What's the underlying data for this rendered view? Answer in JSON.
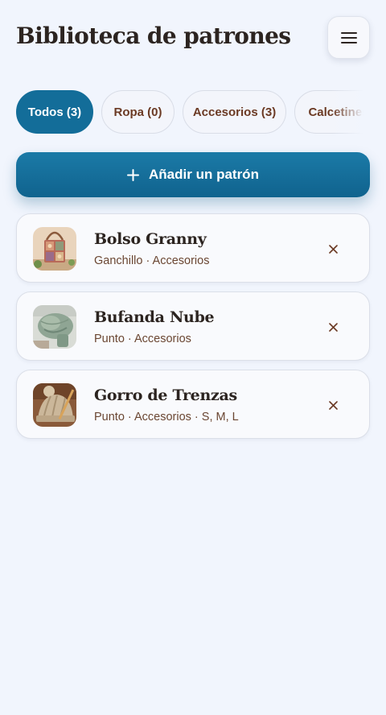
{
  "header": {
    "title": "Biblioteca de patrones",
    "menu_icon": "hamburger-menu-icon"
  },
  "filters": [
    {
      "label": "Todos (3)",
      "active": true
    },
    {
      "label": "Ropa (0)",
      "active": false
    },
    {
      "label": "Accesorios (3)",
      "active": false
    },
    {
      "label": "Calcetines",
      "active": false
    }
  ],
  "add_button": {
    "label": "Añadir un patrón",
    "icon": "plus-icon"
  },
  "patterns": [
    {
      "name": "Bolso Granny",
      "meta": "Ganchillo · Accesorios",
      "thumb": "granny-bag-photo"
    },
    {
      "name": "Bufanda Nube",
      "meta": "Punto · Accesorios",
      "thumb": "cloud-scarf-photo"
    },
    {
      "name": "Gorro de Trenzas",
      "meta": "Punto · Accesorios · S, M, L",
      "thumb": "cable-hat-photo"
    }
  ],
  "colors": {
    "accent": "#136d99",
    "background": "#f1f5fd",
    "title_text": "#2c2420",
    "meta_text": "#6a4632",
    "remove_icon": "#6b3a24"
  }
}
